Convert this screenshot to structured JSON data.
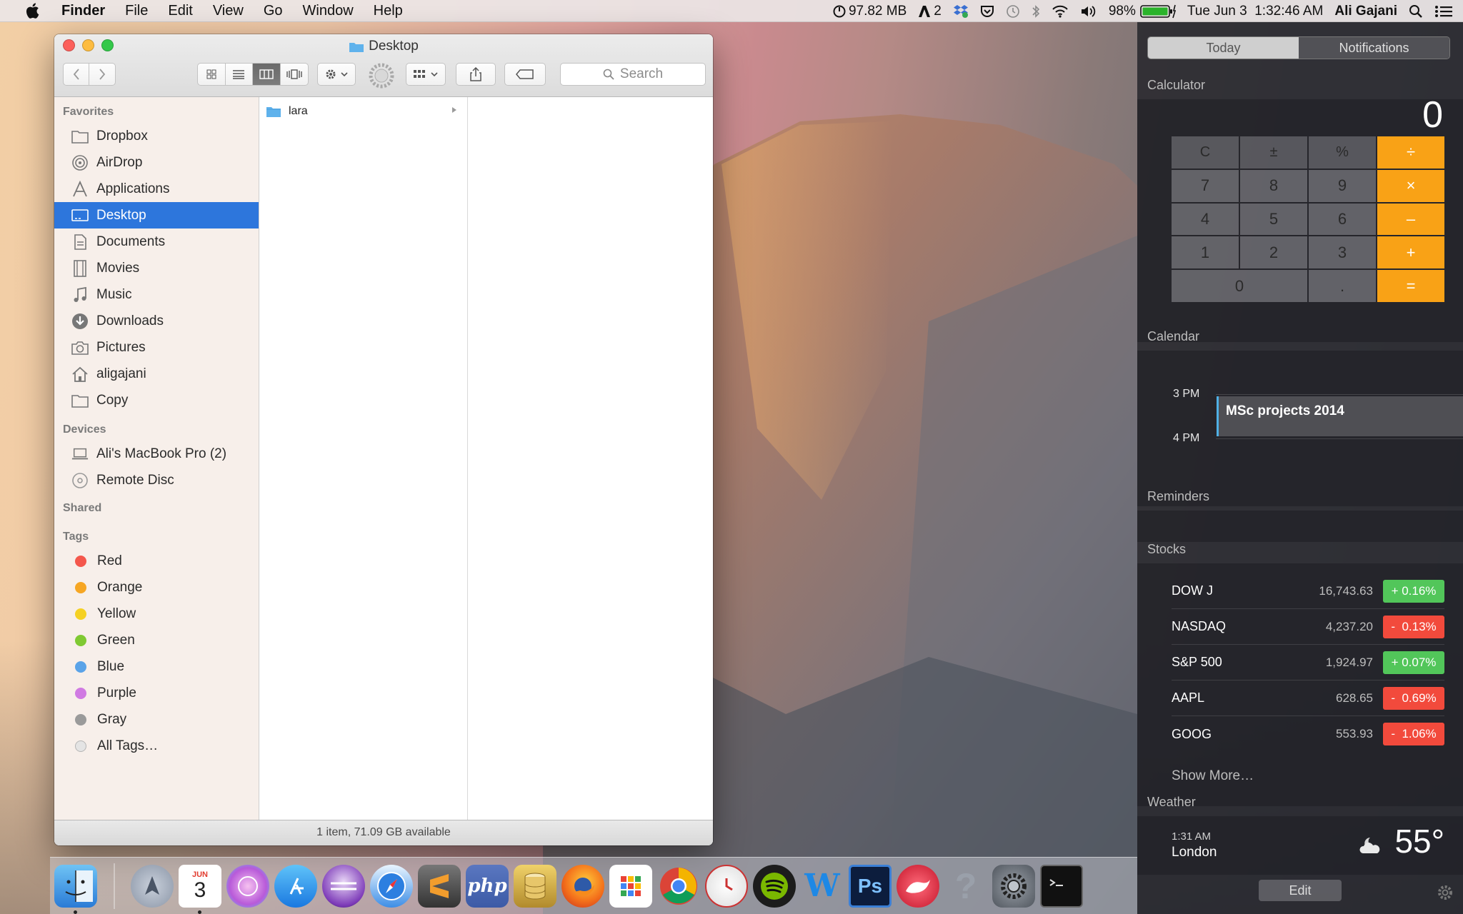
{
  "menubar": {
    "app": "Finder",
    "menus": [
      "File",
      "Edit",
      "View",
      "Go",
      "Window",
      "Help"
    ],
    "memory": "97.82 MB",
    "adobe_count": "2",
    "battery": "98%",
    "datetime": "Tue Jun 3  1:32:46 AM",
    "user": "Ali Gajani"
  },
  "finder": {
    "title": "Desktop",
    "search_placeholder": "Search",
    "sidebar": {
      "favorites_header": "Favorites",
      "favorites": [
        "Dropbox",
        "AirDrop",
        "Applications",
        "Desktop",
        "Documents",
        "Movies",
        "Music",
        "Downloads",
        "Pictures",
        "aligajani",
        "Copy"
      ],
      "devices_header": "Devices",
      "devices": [
        "Ali's MacBook Pro (2)",
        "Remote Disc"
      ],
      "shared_header": "Shared",
      "tags_header": "Tags",
      "tags": [
        {
          "name": "Red",
          "color": "#f4574c"
        },
        {
          "name": "Orange",
          "color": "#f6a623"
        },
        {
          "name": "Yellow",
          "color": "#f5d123"
        },
        {
          "name": "Green",
          "color": "#7fc932"
        },
        {
          "name": "Blue",
          "color": "#5aa3e8"
        },
        {
          "name": "Purple",
          "color": "#d07ae2"
        },
        {
          "name": "Gray",
          "color": "#9a9a9a"
        }
      ],
      "all_tags": "All Tags…"
    },
    "column_items": [
      "lara"
    ],
    "status": "1 item, 71.09 GB available"
  },
  "notification_center": {
    "tab_today": "Today",
    "tab_notifications": "Notifications",
    "calculator": {
      "header": "Calculator",
      "display": "0",
      "keys": [
        "C",
        "±",
        "%",
        "÷",
        "7",
        "8",
        "9",
        "×",
        "4",
        "5",
        "6",
        "–",
        "1",
        "2",
        "3",
        "+",
        "0",
        ".",
        "="
      ]
    },
    "calendar": {
      "header": "Calendar",
      "time1": "3 PM",
      "time2": "4 PM",
      "event": "MSc projects 2014"
    },
    "reminders_header": "Reminders",
    "stocks": {
      "header": "Stocks",
      "items": [
        {
          "name": "DOW J",
          "price": "16,743.63",
          "change": "+ 0.16%",
          "dir": "up"
        },
        {
          "name": "NASDAQ",
          "price": "4,237.20",
          "change": "-  0.13%",
          "dir": "down"
        },
        {
          "name": "S&P 500",
          "price": "1,924.97",
          "change": "+ 0.07%",
          "dir": "up"
        },
        {
          "name": "AAPL",
          "price": "628.65",
          "change": "-  0.69%",
          "dir": "down"
        },
        {
          "name": "GOOG",
          "price": "553.93",
          "change": "-  1.06%",
          "dir": "down"
        }
      ],
      "show_more": "Show More…"
    },
    "weather": {
      "header": "Weather",
      "time": "1:31 AM",
      "city": "London",
      "temp": "55°"
    },
    "edit_button": "Edit"
  },
  "dock": {
    "calendar_month": "JUN",
    "calendar_day": "3",
    "php_label": "php",
    "photoshop_label": "Ps",
    "w_label": "W",
    "help_label": "?"
  }
}
